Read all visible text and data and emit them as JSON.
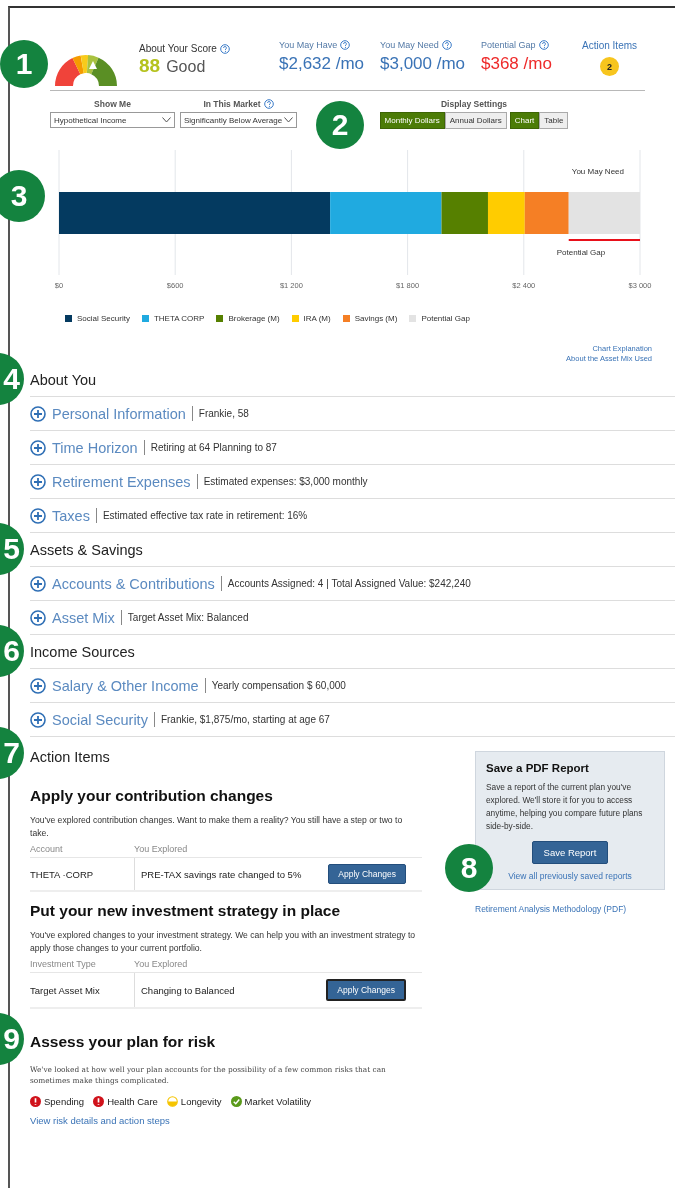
{
  "score": {
    "label": "About Your Score",
    "help": true,
    "value": "88",
    "rating": "Good",
    "callout": "1"
  },
  "summary": [
    {
      "label": "You May Have",
      "help": true,
      "value": "$2,632 /mo",
      "kind": "amount"
    },
    {
      "label": "You May Need",
      "help": true,
      "value": "$3,000 /mo",
      "kind": "amount"
    },
    {
      "label": "Potential Gap",
      "help": true,
      "value": "$368 /mo",
      "kind": "gap"
    }
  ],
  "action_items_link": {
    "label": "Action Items",
    "count": "2"
  },
  "controls": {
    "callout": "2",
    "show_me": {
      "label": "Show Me",
      "value": "Hypothetical Income"
    },
    "market": {
      "label": "In This Market",
      "help": true,
      "value": "Significantly Below Average"
    },
    "display_settings": {
      "label": "Display Settings",
      "units": [
        {
          "label": "Monthly Dollars",
          "selected": true
        },
        {
          "label": "Annual Dollars",
          "selected": false
        }
      ],
      "views": [
        {
          "label": "Chart",
          "selected": true
        },
        {
          "label": "Table",
          "selected": false
        }
      ]
    }
  },
  "chart": {
    "callout": "3",
    "chart_data": {
      "type": "bar",
      "orientation": "horizontal",
      "stacked": true,
      "grid": true,
      "xlim": [
        0,
        3000
      ],
      "xticks": [
        {
          "value": 0,
          "label": "$0"
        },
        {
          "value": 600,
          "label": "$600"
        },
        {
          "value": 1200,
          "label": "$1 200"
        },
        {
          "value": 1800,
          "label": "$1 800"
        },
        {
          "value": 2400,
          "label": "$2 400"
        },
        {
          "value": 3000,
          "label": "$3 000"
        }
      ],
      "series": [
        {
          "name": "Social Security",
          "color": "#043a60",
          "values": [
            1400
          ]
        },
        {
          "name": "THETA CORP",
          "color": "#20aae0",
          "values": [
            575
          ]
        },
        {
          "name": "Brokerage (M)",
          "color": "#568000",
          "values": [
            240
          ]
        },
        {
          "name": "IRA (M)",
          "color": "#ffcc00",
          "values": [
            190
          ]
        },
        {
          "name": "Savings (M)",
          "color": "#f57f25",
          "values": [
            227
          ]
        },
        {
          "name": "Potential Gap",
          "color": "#e3e3e3",
          "values": [
            368
          ]
        }
      ]
    },
    "target_label": "You May Need",
    "gap_label": "Potential Gap",
    "links": [
      "Chart Explanation",
      "About the Asset Mix Used"
    ]
  },
  "sections": [
    {
      "title": "About You",
      "callout": "4",
      "items": [
        {
          "label": "Personal Information",
          "detail": "Frankie, 58",
          "expanded": false
        },
        {
          "label": "Time Horizon",
          "detail": "Retiring at 64 Planning to 87",
          "expanded": false
        },
        {
          "label": "Retirement Expenses",
          "detail": "Estimated expenses: $3,000 monthly",
          "expanded": false
        },
        {
          "label": "Taxes",
          "detail": "Estimated effective tax rate in retirement: 16%",
          "expanded": false
        }
      ]
    },
    {
      "title": "Assets & Savings",
      "callout": "5",
      "items": [
        {
          "label": "Accounts & Contributions",
          "detail": "Accounts Assigned: 4 | Total Assigned Value: $242,240",
          "expanded": false
        },
        {
          "label": "Asset Mix",
          "detail": "Target Asset Mix: Balanced",
          "expanded": false
        }
      ]
    },
    {
      "title": "Income Sources",
      "callout": "6",
      "items": [
        {
          "label": "Salary & Other Income",
          "detail": "Yearly compensation $ 60,000",
          "expanded": false
        },
        {
          "label": "Social Security",
          "detail": "Frankie, $1,875/mo, starting at age 67",
          "expanded": false
        }
      ]
    }
  ],
  "action_items": {
    "title": "Action Items",
    "callout": "7",
    "cards": [
      {
        "title": "Apply your contribution changes",
        "text": "You've explored contribution changes. Want to make them a reality? You still have a step or two to take.",
        "columns": [
          "Account",
          "You Explored"
        ],
        "rows": [
          {
            "cells": [
              "THETA ·CORP",
              "PRE-TAX savings rate changed to 5%"
            ],
            "button": "Apply Changes",
            "focused": false
          }
        ]
      },
      {
        "title": "Put your new investment strategy in place",
        "text": "You've explored changes to your investment strategy. We can help you with an investment strategy to apply those changes to your current portfolio.",
        "columns": [
          "Investment Type",
          "You Explored"
        ],
        "rows": [
          {
            "cells": [
              "Target Asset Mix",
              "Changing to Balanced"
            ],
            "button": "Apply Changes",
            "focused": true
          }
        ]
      }
    ]
  },
  "risk": {
    "title": "Assess your plan for risk",
    "callout": "9",
    "text": "We've looked at how well your plan accounts for the possibility of a few common risks that can sometimes make things complicated.",
    "items": [
      {
        "label": "Spending",
        "kind": "alert"
      },
      {
        "label": "Health Care",
        "kind": "alert"
      },
      {
        "label": "Longevity",
        "kind": "moderate"
      },
      {
        "label": "Market Volatility",
        "kind": "good"
      }
    ],
    "link": "View risk details and action steps"
  },
  "pdf_report": {
    "title": "Save a PDF Report",
    "callout": "8",
    "text": "Save a report of the current plan you've explored. We'll store it for you to access anytime, helping you compare future plans side-by-side.",
    "button": "Save Report",
    "link": "View all previously saved reports"
  },
  "methodology_link": "Retirement Analysis Methodology (PDF)"
}
